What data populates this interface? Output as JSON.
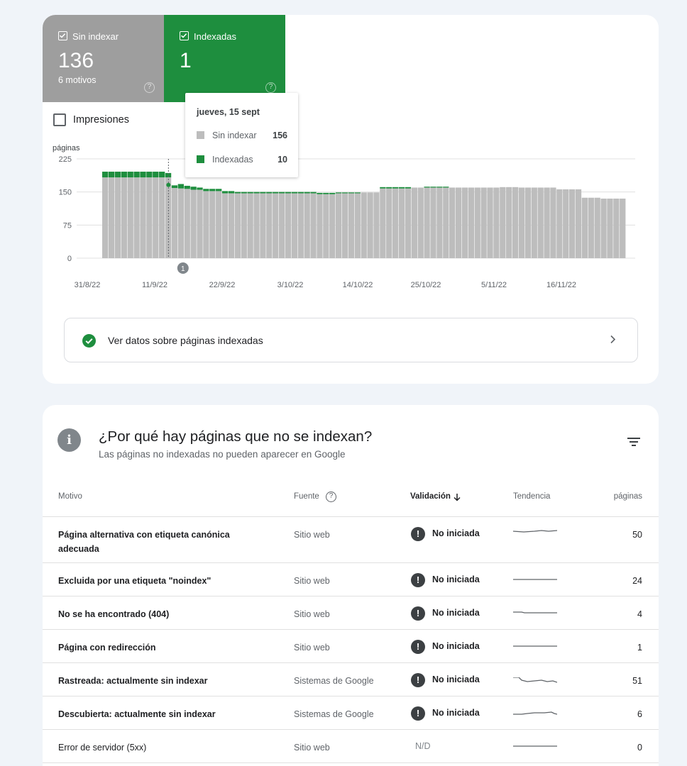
{
  "stats": {
    "not_indexed": {
      "label": "Sin indexar",
      "value": "136",
      "sub": "6 motivos",
      "color": "#9e9e9e"
    },
    "indexed": {
      "label": "Indexadas",
      "value": "1",
      "color": "#1e8e3e"
    }
  },
  "impressions_label": "Impresiones",
  "chart_data": {
    "type": "bar",
    "stacked": true,
    "ylabel": "páginas",
    "yticks": [
      0,
      75,
      150,
      225
    ],
    "ylim": [
      0,
      225
    ],
    "xtick_labels": [
      "31/8/22",
      "11/9/22",
      "22/9/22",
      "3/10/22",
      "14/10/22",
      "25/10/22",
      "5/11/22",
      "16/11/22"
    ],
    "annotation": "1",
    "series": [
      {
        "name": "Sin indexar",
        "color": "#bdbdbd",
        "values": [
          183,
          183,
          183,
          183,
          183,
          183,
          183,
          183,
          183,
          183,
          183,
          159,
          158,
          157,
          155,
          155,
          152,
          152,
          152,
          147,
          147,
          147,
          147,
          147,
          147,
          147,
          147,
          147,
          147,
          147,
          147,
          147,
          147,
          147,
          145,
          145,
          145,
          147,
          147,
          147,
          147,
          149,
          149,
          149,
          158,
          158,
          158,
          158,
          158,
          160,
          160,
          160,
          160,
          160,
          160,
          160,
          160,
          160,
          160,
          160,
          160,
          160,
          160,
          161,
          161,
          161,
          160,
          160,
          160,
          160,
          160,
          160,
          156,
          156,
          156,
          156,
          137,
          137,
          137,
          135,
          135,
          135,
          135
        ]
      },
      {
        "name": "Indexadas",
        "color": "#1e8e3e",
        "values": [
          13,
          13,
          13,
          13,
          13,
          13,
          13,
          13,
          13,
          13,
          10,
          6,
          10,
          7,
          7,
          5,
          5,
          5,
          5,
          5,
          5,
          3,
          3,
          3,
          3,
          3,
          3,
          3,
          3,
          3,
          3,
          3,
          3,
          3,
          3,
          3,
          3,
          2,
          2,
          2,
          2,
          0,
          0,
          0,
          3,
          3,
          3,
          3,
          3,
          0,
          0,
          2,
          2,
          2,
          2,
          0,
          0,
          0,
          0,
          0,
          0,
          0,
          0,
          0,
          0,
          0,
          0,
          0,
          0,
          0,
          0,
          0,
          0,
          0,
          0,
          0,
          0,
          0,
          0,
          0,
          0,
          0,
          0
        ]
      }
    ]
  },
  "tooltip": {
    "date": "jueves, 15 sept",
    "rows": [
      {
        "name": "Sin indexar",
        "value": "156",
        "color": "#bdbdbd"
      },
      {
        "name": "Indexadas",
        "value": "10",
        "color": "#1e8e3e"
      }
    ]
  },
  "view_indexed": "Ver datos sobre páginas indexadas",
  "section": {
    "title": "¿Por qué hay páginas que no se indexan?",
    "subtitle": "Las páginas no indexadas no pueden aparecer en Google"
  },
  "table": {
    "headers": {
      "reason": "Motivo",
      "source": "Fuente",
      "validation": "Validación",
      "trend": "Tendencia",
      "pages": "páginas"
    },
    "rows": [
      {
        "reason": "Página alternativa con etiqueta canónica adecuada",
        "source": "Sitio web",
        "validation": "No iniciada",
        "pages": "50"
      },
      {
        "reason": "Excluida por una etiqueta \"noindex\"",
        "source": "Sitio web",
        "validation": "No iniciada",
        "pages": "24"
      },
      {
        "reason": "No se ha encontrado (404)",
        "source": "Sitio web",
        "validation": "No iniciada",
        "pages": "4"
      },
      {
        "reason": "Página con redirección",
        "source": "Sitio web",
        "validation": "No iniciada",
        "pages": "1"
      },
      {
        "reason": "Rastreada: actualmente sin indexar",
        "source": "Sistemas de Google",
        "validation": "No iniciada",
        "pages": "51"
      },
      {
        "reason": "Descubierta: actualmente sin indexar",
        "source": "Sistemas de Google",
        "validation": "No iniciada",
        "pages": "6"
      },
      {
        "reason": "Error de servidor (5xx)",
        "source": "Sitio web",
        "validation": "N/D",
        "pages": "0"
      }
    ]
  }
}
